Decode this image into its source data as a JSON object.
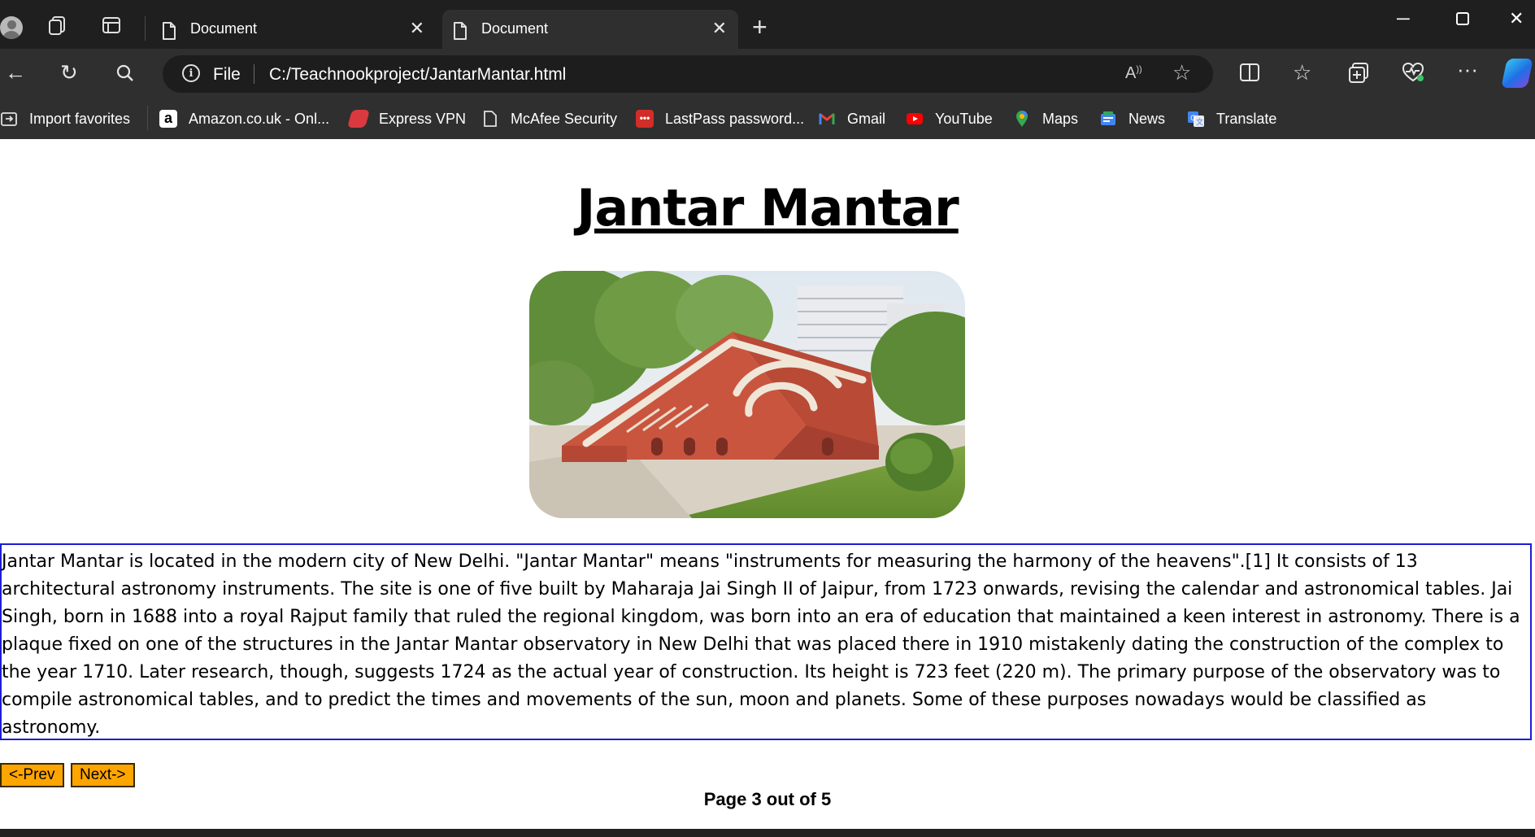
{
  "browser": {
    "tabs": [
      {
        "title": "Document",
        "active": false
      },
      {
        "title": "Document",
        "active": true
      }
    ],
    "address": {
      "scheme_label": "File",
      "url": "C:/Teachnookproject/JantarMantar.html"
    },
    "favorites": [
      {
        "label": "Import favorites",
        "icon": "import-icon"
      },
      {
        "label": "Amazon.co.uk - Onl...",
        "icon": "amazon-icon"
      },
      {
        "label": "Express VPN",
        "icon": "expressvpn-icon"
      },
      {
        "label": "McAfee Security",
        "icon": "page-icon"
      },
      {
        "label": "LastPass password...",
        "icon": "lastpass-icon"
      },
      {
        "label": "Gmail",
        "icon": "gmail-icon"
      },
      {
        "label": "YouTube",
        "icon": "youtube-icon"
      },
      {
        "label": "Maps",
        "icon": "maps-icon"
      },
      {
        "label": "News",
        "icon": "news-icon"
      },
      {
        "label": "Translate",
        "icon": "translate-icon"
      }
    ],
    "theme": {
      "chrome_dark": "#1f1f1f",
      "toolbar": "#2f2f2f"
    }
  },
  "page": {
    "title": "Jantar Mantar",
    "image_alt": "Jantar Mantar",
    "description": "Jantar Mantar is located in the modern city of New Delhi. \"Jantar Mantar\" means \"instruments for measuring the harmony of the heavens\".[1] It consists of 13 architectural astronomy instruments. The site is one of five built by Maharaja Jai Singh II of Jaipur, from 1723 onwards, revising the calendar and astronomical tables. Jai Singh, born in 1688 into a royal Rajput family that ruled the regional kingdom, was born into an era of education that maintained a keen interest in astronomy. There is a plaque fixed on one of the structures in the Jantar Mantar observatory in New Delhi that was placed there in 1910 mistakenly dating the construction of the complex to the year 1710. Later research, though, suggests 1724 as the actual year of construction. Its height is 723 feet (220 m). The primary purpose of the observatory was to compile astronomical tables, and to predict the times and movements of the sun, moon and planets. Some of these purposes nowadays would be classified as astronomy.",
    "prev_label": "<-Prev",
    "next_label": "Next->",
    "page_indicator": "Page 3 out of 5",
    "colors": {
      "button": "#ffa500",
      "description_border": "#1d1dd6"
    }
  }
}
